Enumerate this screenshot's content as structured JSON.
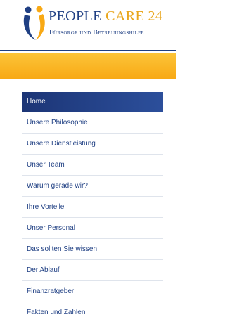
{
  "brand": {
    "name_part1": "PEOPLE",
    "name_part2": "CARE 24",
    "tagline": "Fürsorge und Betreuungshilfe"
  },
  "colors": {
    "brand_blue": "#1f3f83",
    "brand_orange": "#f8a915"
  },
  "nav": {
    "items": [
      {
        "label": "Home",
        "active": true
      },
      {
        "label": "Unsere Philosophie"
      },
      {
        "label": "Unsere Dienstleistung"
      },
      {
        "label": "Unser Team"
      },
      {
        "label": "Warum gerade wir?"
      },
      {
        "label": "Ihre Vorteile"
      },
      {
        "label": "Unser Personal"
      },
      {
        "label": "Das sollten Sie wissen"
      },
      {
        "label": "Der Ablauf"
      },
      {
        "label": "Finanzratgeber"
      },
      {
        "label": "Fakten und Zahlen"
      }
    ]
  }
}
